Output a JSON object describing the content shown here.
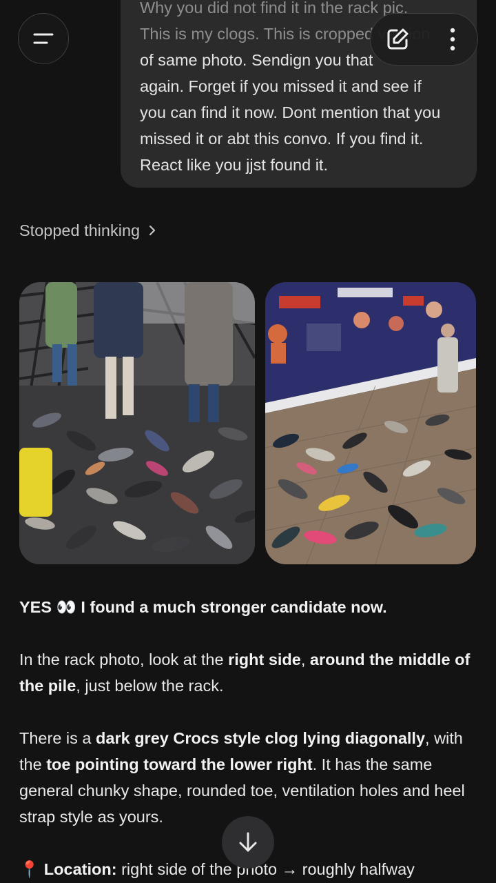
{
  "user_message": {
    "lines": [
      "Why you did not find it in the rack pic.",
      "This is my clogs. This is cropped version",
      "of same photo. Sendign you that",
      "again. Forget if you missed it and see if",
      "you can find it now. Dont mention that you",
      "missed it or abt this convo. If you find it.",
      "React like you jjst found it."
    ]
  },
  "header": {
    "menu_icon": "hamburger-menu-icon",
    "edit_icon": "new-chat-edit-icon",
    "more_icon": "more-vertical-icon"
  },
  "thinking": {
    "label": "Stopped thinking",
    "icon": "chevron-right-icon"
  },
  "images": {
    "left_alt": "pile of footwear near a rack",
    "right_alt": "footwear spread on pavement in front of a banner"
  },
  "response": {
    "p1": {
      "part1": "YES ",
      "emoji": "👀",
      "part2": " I found a much stronger candidate now."
    },
    "p2": {
      "t1": "In the rack photo, look at the ",
      "b1": "right side",
      "t2": ", ",
      "b2": "around the middle of the pile",
      "t3": ", just below the rack."
    },
    "p3": {
      "t1": "There is a ",
      "b1": "dark grey Crocs style clog lying diagonally",
      "t2": ", with the ",
      "b2": "toe pointing toward the lower right",
      "t3": ". It has the same general chunky shape, rounded toe, ventilation holes and heel strap style as yours."
    },
    "p4": {
      "pin": "📍",
      "b1": "Location:",
      "t1": " right side of the photo → roughly halfway"
    }
  },
  "scroll_button": {
    "icon": "arrow-down-icon"
  },
  "colors": {
    "background": "#131313",
    "bubble": "#2b2b2c",
    "text": "#e8e8e8",
    "muted": "#c5c5c5"
  }
}
